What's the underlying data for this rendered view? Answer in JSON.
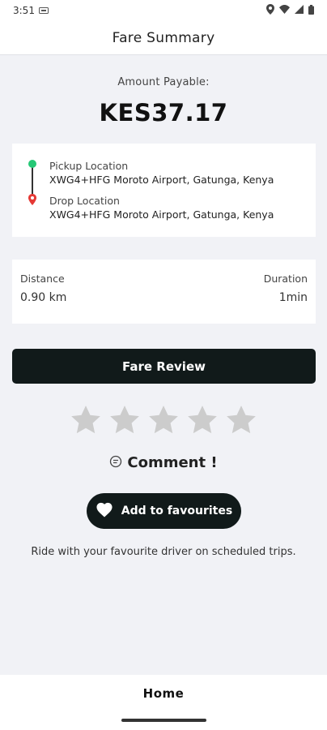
{
  "status_bar": {
    "time": "3:51",
    "icons": [
      "sim-icon",
      "location-icon",
      "wifi-icon",
      "signal-icon",
      "battery-icon"
    ]
  },
  "header": {
    "title": "Fare Summary"
  },
  "amount": {
    "label": "Amount Payable:",
    "value": "KES37.17"
  },
  "route": {
    "pickup_label": "Pickup Location",
    "pickup_address": "XWG4+HFG Moroto Airport, Gatunga, Kenya",
    "drop_label": "Drop Location",
    "drop_address": "XWG4+HFG Moroto Airport, Gatunga, Kenya"
  },
  "trip": {
    "distance_label": "Distance",
    "distance_value": "0.90 km",
    "duration_label": "Duration",
    "duration_value": "1min"
  },
  "fare_review": {
    "label": "Fare Review"
  },
  "rating": {
    "max": 5,
    "value": 0
  },
  "comment": {
    "label": "Comment !"
  },
  "favourites": {
    "button_label": "Add to favourites",
    "hint": "Ride with your favourite driver on scheduled trips."
  },
  "bottom_nav": {
    "home_label": "Home"
  },
  "colors": {
    "background": "#f1f2f6",
    "dark_button": "#111a1a",
    "pickup_green": "#26c876",
    "drop_red": "#e53935",
    "star_gray": "#cccccc"
  }
}
